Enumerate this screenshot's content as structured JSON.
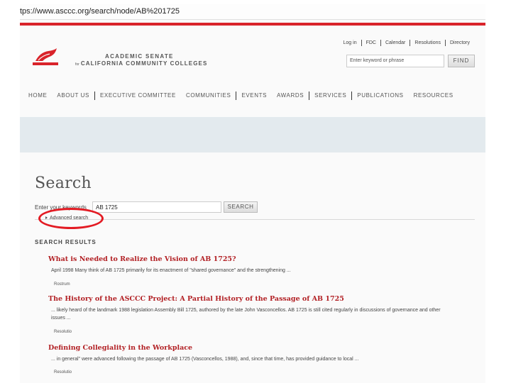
{
  "browser": {
    "url": "tps://www.asccc.org/search/node/AB%201725"
  },
  "colors": {
    "accent_red": "#d9232a",
    "band": "#e3eaee",
    "link_red": "#b22024",
    "annotation_red": "#e31b23"
  },
  "header": {
    "brand_line1": "ACADEMIC SENATE",
    "brand_for": "for",
    "brand_line2": "CALIFORNIA COMMUNITY COLLEGES",
    "logo_icon": "senate-logo-icon",
    "top_links": [
      "Log in",
      "FDC",
      "Calendar",
      "Resolutions",
      "Directory"
    ],
    "search_placeholder": "Enter keyword or phrase",
    "find_label": "FIND"
  },
  "nav": {
    "items": [
      "HOME",
      "ABOUT US",
      "EXECUTIVE COMMITTEE",
      "COMMUNITIES",
      "EVENTS",
      "AWARDS",
      "SERVICES",
      "PUBLICATIONS",
      "RESOURCES"
    ]
  },
  "search": {
    "title": "Search",
    "keyword_label": "Enter your keywords",
    "keyword_value": "AB 1725",
    "button_label": "SEARCH",
    "advanced_label": "Advanced search",
    "results_heading": "SEARCH RESULTS"
  },
  "results": [
    {
      "title": "What is Needed to Realize the Vision of AB 1725?",
      "snippet": "April 1998 Many think of AB 1725 primarily for its enactment of \"shared governance\" and the strengthening ...",
      "type": "Rostrum"
    },
    {
      "title": "The History of the ASCCC Project: A Partial History of the Passage of AB 1725",
      "snippet": "... likely heard of the landmark 1988 legislation Assembly Bill 1725, authored by the late John Vasconcellos. AB 1725 is still cited regularly in discussions of governance and other issues ...",
      "type": "Rostrum"
    },
    {
      "title": "Defining Collegiality in the Workplace",
      "snippet": "... in general\" were advanced following the passage of AB 1725 (Vasconcellos, 1988), and, since that time, has provided guidance to local ...",
      "type": "Resolutio"
    }
  ]
}
